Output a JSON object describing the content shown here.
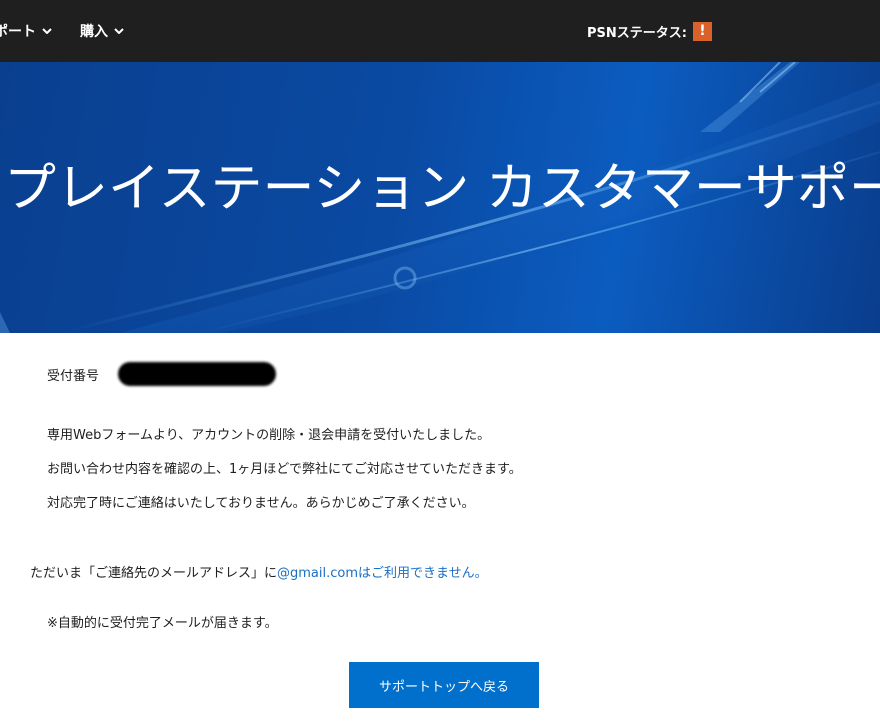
{
  "nav": {
    "support_label": "ポート",
    "buy_label": "購入",
    "psn_status_label": "PSNステータス:",
    "alert_glyph": "!"
  },
  "hero": {
    "title": "プレイステーション カスタマーサポート"
  },
  "content": {
    "receipt_label": "受付番号",
    "messages": [
      "専用Webフォームより、アカウントの削除・退会申請を受付いたしました。",
      "お問い合わせ内容を確認の上、1ヶ月ほどで弊社にてご対応させていただきます。",
      "対応完了時にご連絡はいたしておりません。あらかじめご了承ください。"
    ],
    "email_note_prefix": "ただいま「ご連絡先のメールアドレス」に",
    "email_note_link": "@gmail.comはご利用できません。",
    "auto_note": "※自動的に受付完了メールが届きます。",
    "back_button_label": "サポートトップへ戻る"
  },
  "colors": {
    "nav_bg": "#1f1f1f",
    "alert": "#d9622b",
    "hero_blue": "#0a4aa3",
    "button_blue": "#0070cc",
    "link_blue": "#1a6fc4"
  }
}
